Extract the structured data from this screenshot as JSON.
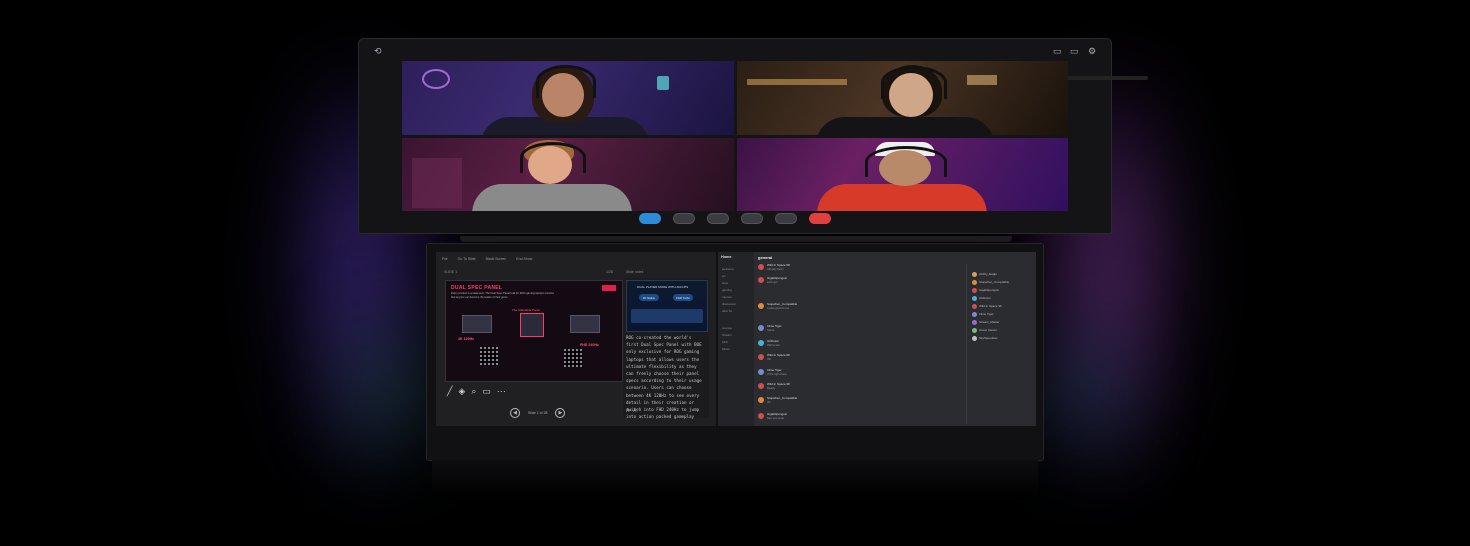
{
  "colors": {
    "accent_pink": "#ff3b6b",
    "call_blue": "#2d8cd8",
    "call_red": "#e04040"
  },
  "lid": {
    "sys_icons": [
      "back-icon",
      "window-icon",
      "monitor-icon",
      "gear-icon"
    ],
    "video_tiles": [
      {
        "name": "participant-1"
      },
      {
        "name": "participant-2"
      },
      {
        "name": "participant-3"
      },
      {
        "name": "participant-4"
      }
    ],
    "call_controls": [
      "mic-icon",
      "video-icon",
      "share-icon",
      "screen-icon",
      "more-icon",
      "hangup-icon"
    ]
  },
  "presentation": {
    "toolbar": [
      "File",
      "Go To Slide",
      "Black Screen",
      "End Show"
    ],
    "slide_label": "SLIDE 1",
    "slide_count": "1/28",
    "notes_label": "Slide notes",
    "slide": {
      "title": "DUAL SPEC PANEL",
      "body": "Every product is a statement. The Dual Spec Panel built for ROG gaming laptops ensures that anyone can become the leader of their genre.",
      "chip_label": "The Adaptable Panel",
      "left_spec": "4K 120Hz",
      "right_spec": "FHD 240Hz"
    },
    "thumb": {
      "title": "DUAL PLAYER MODE WITH 200 FPS",
      "pill_left": "4K Native",
      "pill_right": "FHD Turbo"
    },
    "notes_text": "ROG co-created the world's first Dual Spec Panel with BOE only exclusive for ROG gaming laptops that allows users the ultimate flexibility as they can freely choose their panel specs according to their usage scenario. Users can choose between 4K 120Hz to see every detail in their creation or switch into FHD 240Hz to jump into action packed gameplay",
    "pager_text": "Slide 1 of 28"
  },
  "chat": {
    "server": "Home",
    "channel": "general",
    "channels": [
      "welcome",
      "art",
      "clips",
      "gaming",
      "memes",
      "discussion",
      "after 5s"
    ],
    "voice_channels": [
      "Lounge",
      "Stream",
      "AFK",
      "Music"
    ],
    "messages": [
      {
        "name": "Wild In Space 98",
        "text": "Already here!",
        "color": "#d05050"
      },
      {
        "name": "Gigabitpenguin",
        "text": "Let's go!",
        "color": "#d05050"
      },
      {
        "name": "Stopwhen_Compatible",
        "text": "Looks good to me",
        "color": "#e08a3a"
      },
      {
        "name": "Inline Tiger",
        "text": "Same",
        "color": "#7a8acd"
      },
      {
        "name": "Ghibulon",
        "text": "Wait a sec",
        "color": "#4ab0d8"
      },
      {
        "name": "Wild In Space 98",
        "text": "OK",
        "color": "#d05050"
      },
      {
        "name": "Inline Tiger",
        "text": "I'll be right there",
        "color": "#7a8acd"
      },
      {
        "name": "Wild In Space 98",
        "text": "Ready",
        "color": "#d05050"
      },
      {
        "name": "Stopwhen_Compatible",
        "text": "Ok",
        "color": "#e08a3a"
      },
      {
        "name": "Gigabitpenguin",
        "text": "See you soon",
        "color": "#d05050"
      }
    ],
    "members": [
      {
        "name": "Ghibly_Eagle",
        "color": "#d0a060"
      },
      {
        "name": "Stopwhen_Compatible",
        "color": "#e08a3a"
      },
      {
        "name": "Gigabitpenguin",
        "color": "#d05050"
      },
      {
        "name": "Ghibulon",
        "color": "#4ab0d8"
      },
      {
        "name": "Wild In Space 98",
        "color": "#d05050"
      },
      {
        "name": "Inline Tiger",
        "color": "#7a8acd"
      },
      {
        "name": "Stream_Master",
        "color": "#9a6ad0"
      },
      {
        "name": "Guest Viewer",
        "color": "#70c070"
      },
      {
        "name": "SkySpeedster",
        "color": "#c0c0c0"
      }
    ]
  }
}
